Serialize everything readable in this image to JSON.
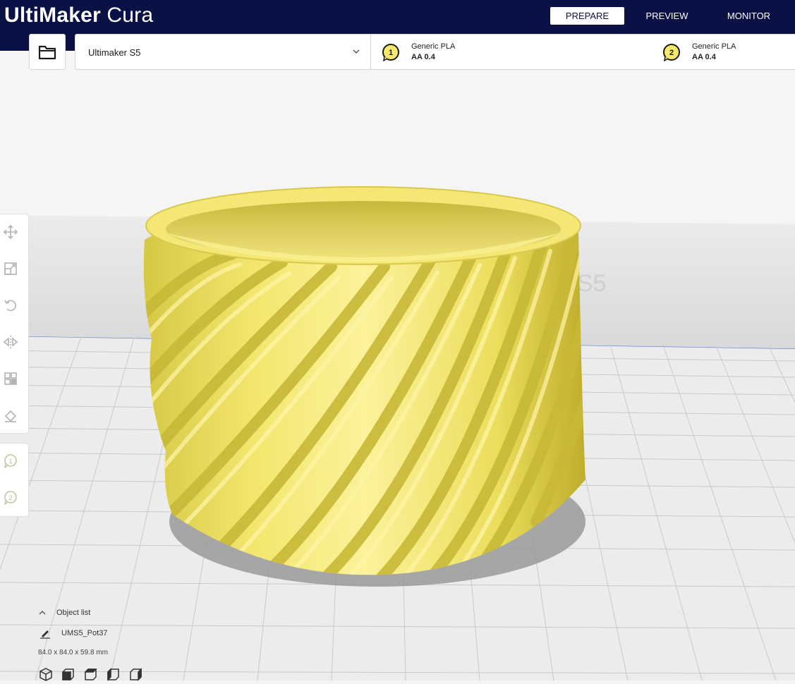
{
  "app": {
    "title_bold": "UltiMaker",
    "title_light": "Cura"
  },
  "stages": [
    {
      "label": "PREPARE",
      "active": true
    },
    {
      "label": "PREVIEW",
      "active": false
    },
    {
      "label": "MONITOR",
      "active": false
    }
  ],
  "open_file": {
    "icon": "folder-icon"
  },
  "printer": {
    "name": "Ultimaker S5"
  },
  "extruders": [
    {
      "number": "1",
      "material": "Generic PLA",
      "nozzle": "AA 0.4"
    },
    {
      "number": "2",
      "material": "Generic PLA",
      "nozzle": "AA 0.4"
    }
  ],
  "viewport": {
    "buildplate_label": "S5",
    "model_color": "#f5e86a"
  },
  "toolbar": {
    "tools": [
      "move-icon",
      "scale-icon",
      "rotate-icon",
      "mirror-icon",
      "per-model-settings-icon",
      "support-blocker-icon"
    ]
  },
  "extruder_selector": {
    "items": [
      "1",
      "2"
    ]
  },
  "object_list": {
    "header": "Object list",
    "item_name": "UMS5_Pot37",
    "dimensions": "84.0 x 84.0 x 59.8 mm"
  },
  "camera_views": [
    "3d-view-icon",
    "front-view-icon",
    "top-view-icon",
    "left-view-icon",
    "right-view-icon"
  ]
}
